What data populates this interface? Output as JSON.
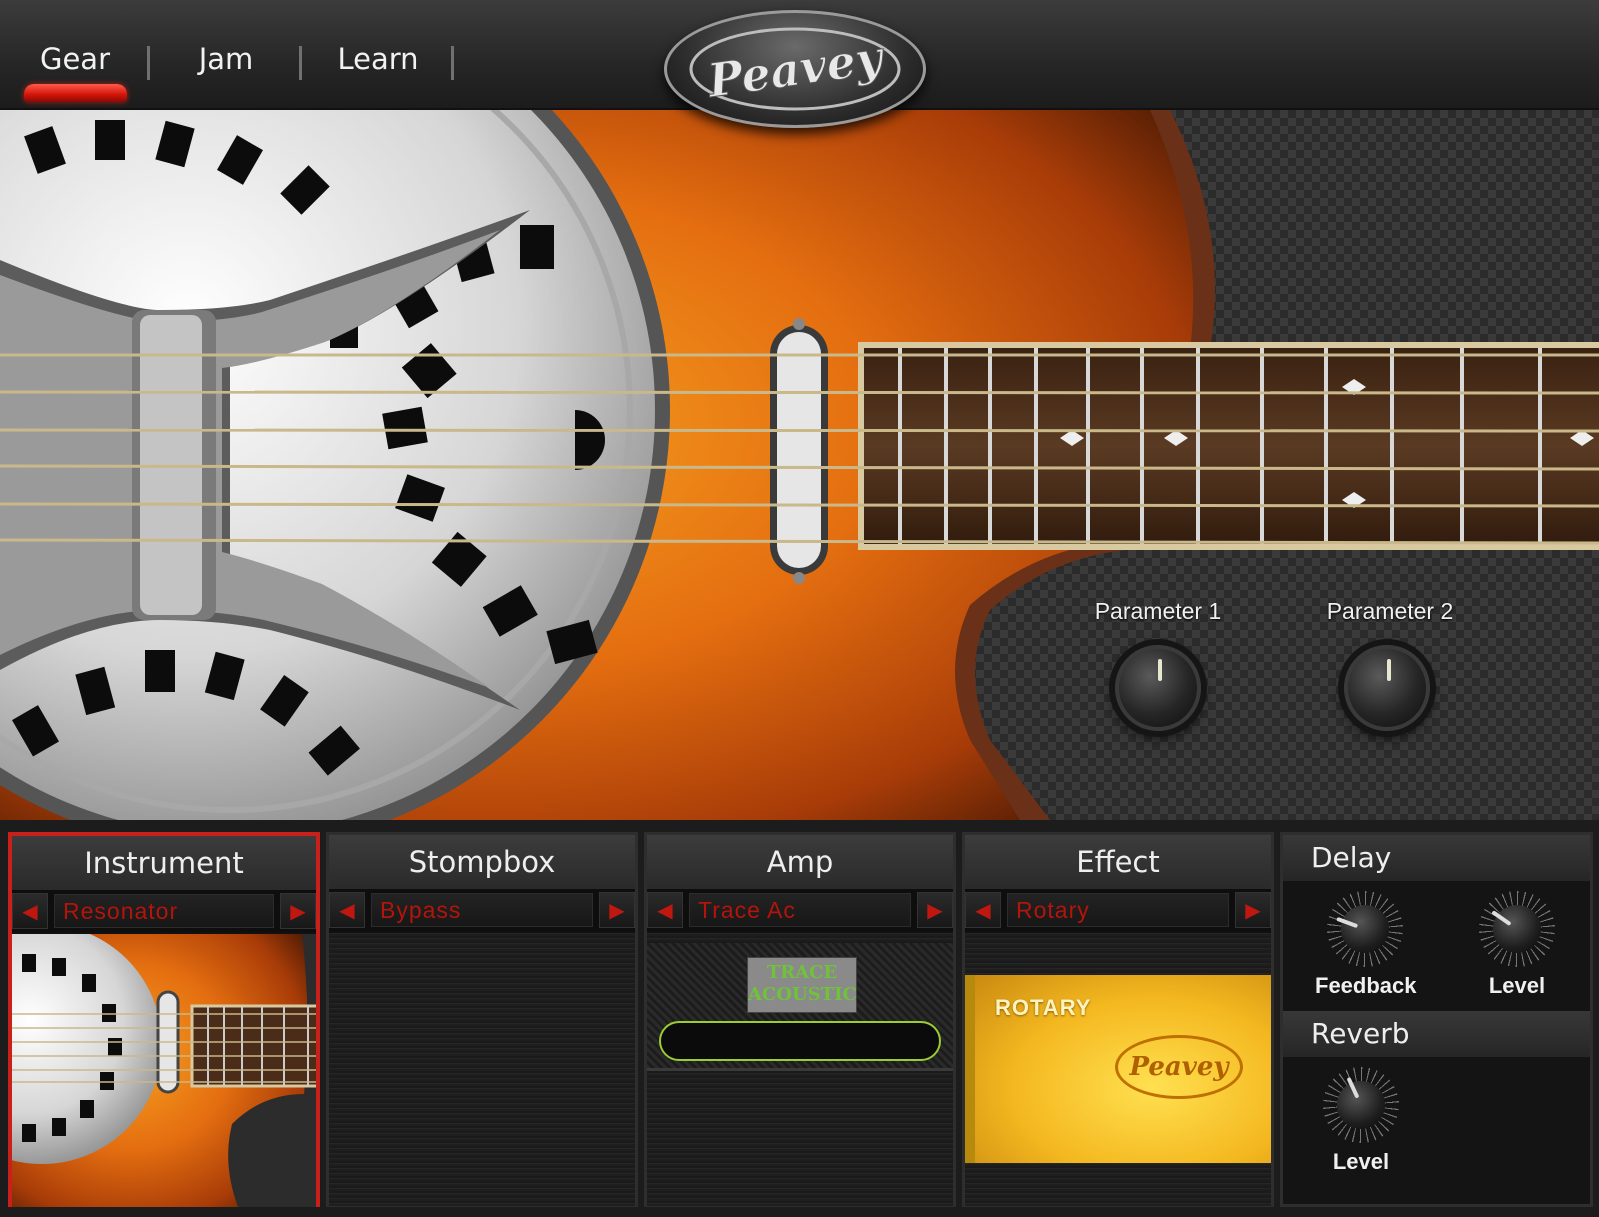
{
  "nav": {
    "tabs": [
      {
        "label": "Gear",
        "active": true
      },
      {
        "label": "Jam",
        "active": false
      },
      {
        "label": "Learn",
        "active": false
      }
    ]
  },
  "brand": {
    "logo_text": "Peavey"
  },
  "hero": {
    "parameter_1_label": "Parameter 1",
    "parameter_2_label": "Parameter 2"
  },
  "slots": {
    "instrument": {
      "title": "Instrument",
      "value": "Resonator"
    },
    "stompbox": {
      "title": "Stompbox",
      "value": "Bypass"
    },
    "amp": {
      "title": "Amp",
      "value": "Trace Ac",
      "image_text": "TRACE ACOUSTIC"
    },
    "effect": {
      "title": "Effect",
      "value": "Rotary",
      "image_text": "ROTARY"
    }
  },
  "delay": {
    "title": "Delay",
    "feedback_label": "Feedback",
    "level_label": "Level"
  },
  "reverb": {
    "title": "Reverb",
    "level_label": "Level"
  },
  "colors": {
    "accent_red": "#c8201a",
    "selector_text": "#b3140c",
    "guitar_orange": "#e46e10"
  },
  "icons": {
    "prev": "arrow-left-icon",
    "next": "arrow-right-icon"
  }
}
